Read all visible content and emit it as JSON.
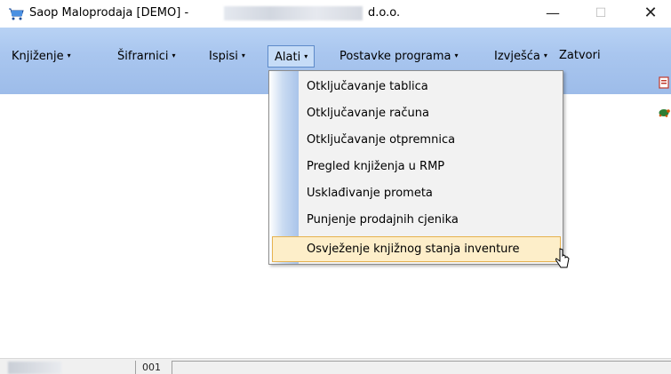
{
  "window": {
    "title_prefix": "Saop Maloprodaja [DEMO] -",
    "title_suffix": "d.o.o.",
    "controls": {
      "minimize": "—",
      "maximize": "☐",
      "close": "✕"
    }
  },
  "menubar": {
    "items": [
      {
        "label": "Knjiženje",
        "arrow": "▾"
      },
      {
        "label": "Šifrarnici",
        "arrow": "▾"
      },
      {
        "label": "Ispisi",
        "arrow": "▾"
      },
      {
        "label": "Alati",
        "arrow": "▾"
      },
      {
        "label": "Postavke programa",
        "arrow": "▾"
      },
      {
        "label": "Izvješća",
        "arrow": "▾"
      },
      {
        "label": "Zatvori"
      }
    ]
  },
  "dropdown": {
    "items": [
      {
        "label": "Otključavanje tablica"
      },
      {
        "label": "Otključavanje računa"
      },
      {
        "label": "Otključavanje otpremnica"
      },
      {
        "label": "Pregled knjiženja u RMP"
      },
      {
        "label": "Usklađivanje prometa"
      },
      {
        "label": "Punjenje prodajnih cjenika"
      },
      {
        "label": "Osvježenje knjižnog stanja inventure",
        "highlighted": true
      }
    ]
  },
  "statusbar": {
    "code": "001"
  },
  "colors": {
    "menubar": "#a9c6ef",
    "open_menu": "#c6dcf7",
    "highlight": "#fdeec9",
    "highlight_border": "#e6b24f"
  }
}
